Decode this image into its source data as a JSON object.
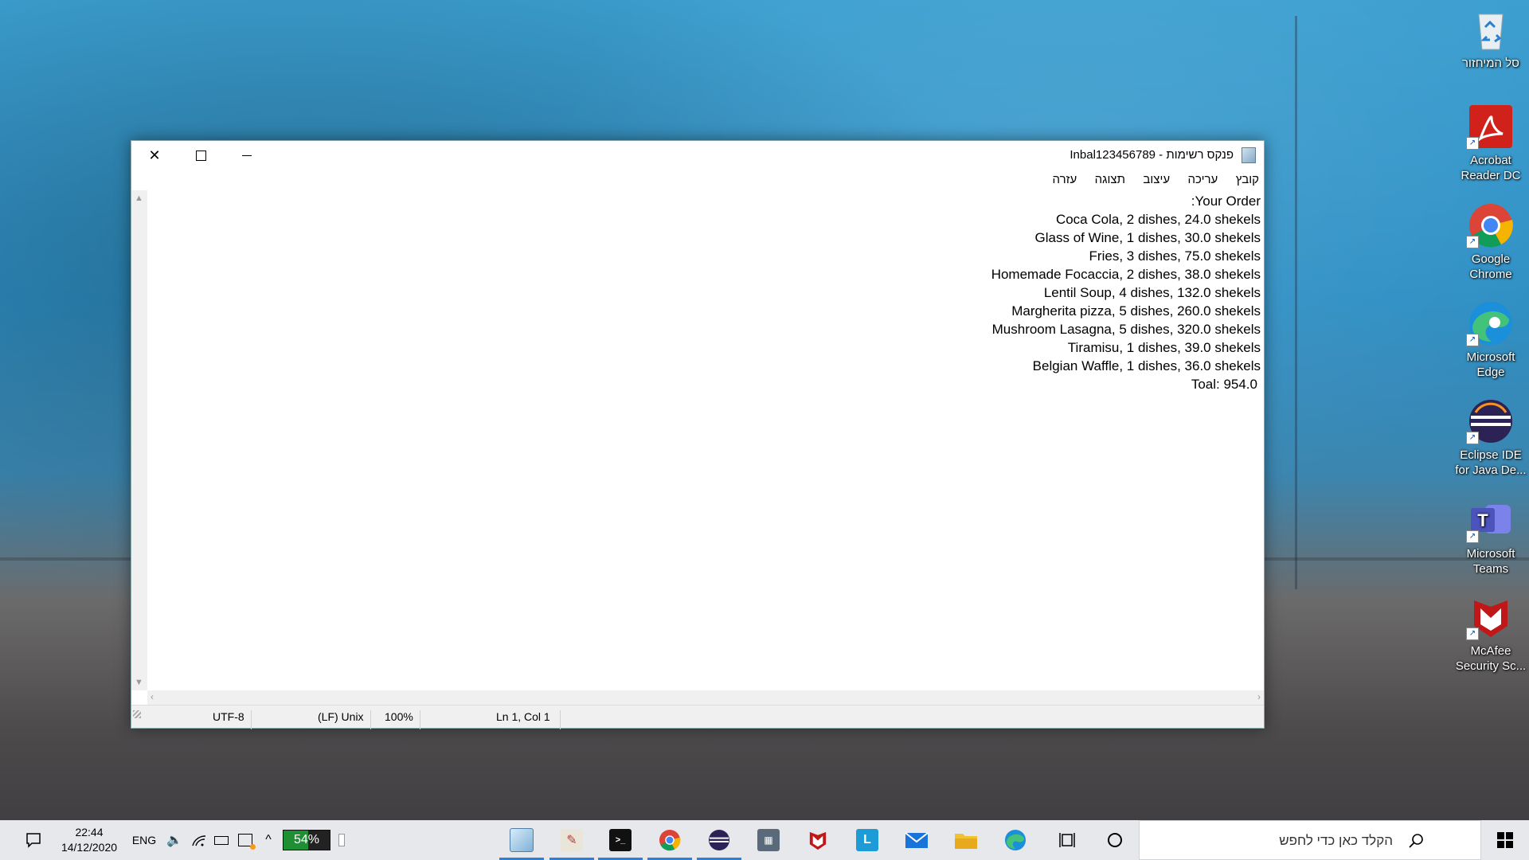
{
  "desktop": {
    "icons": [
      {
        "label": "סל המיחזור",
        "name": "recycle-bin-icon"
      },
      {
        "label": "Acrobat Reader DC",
        "name": "acrobat-reader-icon",
        "color": "#d1211b"
      },
      {
        "label": "Google Chrome",
        "name": "google-chrome-icon"
      },
      {
        "label": "Microsoft Edge",
        "name": "microsoft-edge-icon"
      },
      {
        "label": "Eclipse IDE for Java De...",
        "name": "eclipse-ide-icon"
      },
      {
        "label": "Microsoft Teams",
        "name": "microsoft-teams-icon"
      },
      {
        "label": "McAfee Security Sc...",
        "name": "mcafee-security-icon"
      }
    ]
  },
  "window": {
    "title": "Inbal123456789 - פנקס רשימות",
    "menu": [
      "קובץ",
      "עריכה",
      "עיצוב",
      "תצוגה",
      "עזרה"
    ],
    "lines": [
      "Your Order:",
      "Coca Cola, 2 dishes, 24.0 shekels",
      "Glass of Wine, 1 dishes, 30.0 shekels",
      "Fries, 3 dishes, 75.0 shekels",
      "Homemade Focaccia, 2 dishes, 38.0 shekels",
      "Lentil Soup, 4 dishes, 132.0 shekels",
      "Margherita pizza, 5 dishes, 260.0 shekels",
      "Mushroom Lasagna, 5 dishes, 320.0 shekels",
      "Tiramisu, 1 dishes, 39.0 shekels",
      "Belgian Waffle, 1 dishes, 36.0 shekels",
      "Toal: 954.0"
    ],
    "status": {
      "encoding": "UTF-8",
      "line_ending": "(LF) Unix",
      "zoom": "100%",
      "position": "Ln 1, Col 1"
    }
  },
  "taskbar": {
    "time": "22:44",
    "date": "14/12/2020",
    "language": "ENG",
    "battery": "54%",
    "battery_level": 0.54,
    "search_placeholder": "הקלד כאן כדי לחפש"
  },
  "colors": {
    "accent": "#2f7fd8",
    "battery_fill": "#1f8f33"
  }
}
